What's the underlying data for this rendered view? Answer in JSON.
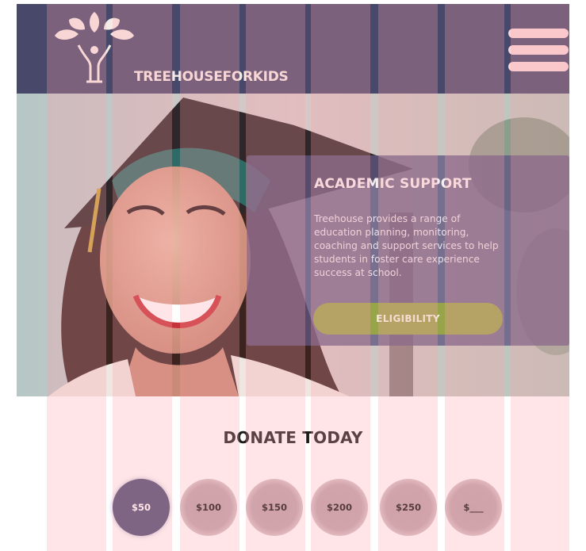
{
  "header": {
    "logo_text": "TREEHOUSEFORKIDS",
    "menu_icon": "hamburger-menu-icon",
    "bg_color": "#48486a"
  },
  "hero": {
    "card": {
      "title": "ACADEMIC SUPPORT",
      "body": "Treehouse provides a range of education planning, monitoring, coaching and support services to help students in foster care experience success at school.",
      "button_label": "ELIGIBILITY",
      "button_color": "#98a44a"
    }
  },
  "donate": {
    "title": "DONATE TODAY",
    "amounts": [
      "$50",
      "$100",
      "$150",
      "$200",
      "$250",
      "$___"
    ],
    "selected": "$50",
    "selected_color": "#4e4e76"
  }
}
